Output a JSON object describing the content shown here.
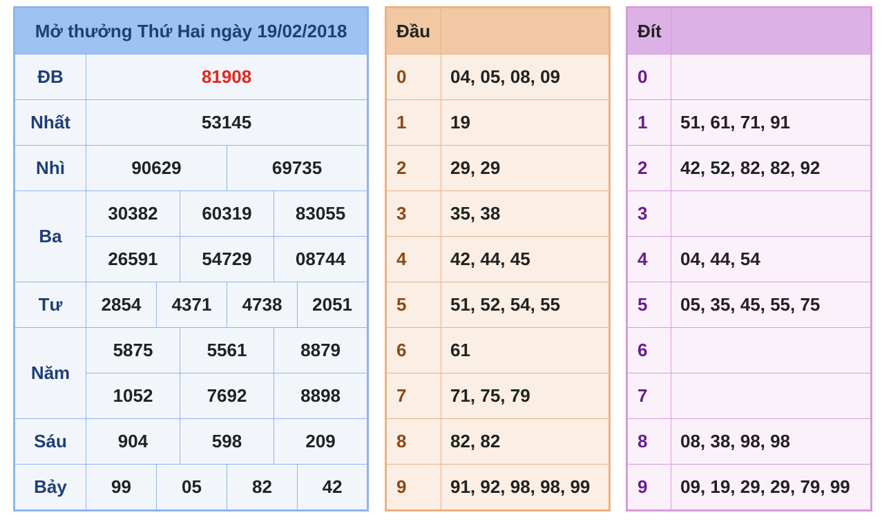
{
  "results": {
    "title": "Mở thưởng Thứ Hai ngày 19/02/2018",
    "prizes": [
      {
        "label": "ĐB",
        "values": [
          "81908"
        ]
      },
      {
        "label": "Nhất",
        "values": [
          "53145"
        ]
      },
      {
        "label": "Nhì",
        "values": [
          "90629",
          "69735"
        ]
      },
      {
        "label": "Ba",
        "values": [
          "30382",
          "60319",
          "83055",
          "26591",
          "54729",
          "08744"
        ]
      },
      {
        "label": "Tư",
        "values": [
          "2854",
          "4371",
          "4738",
          "2051"
        ]
      },
      {
        "label": "Năm",
        "values": [
          "5875",
          "5561",
          "8879",
          "1052",
          "7692",
          "8898"
        ]
      },
      {
        "label": "Sáu",
        "values": [
          "904",
          "598",
          "209"
        ]
      },
      {
        "label": "Bảy",
        "values": [
          "99",
          "05",
          "82",
          "42"
        ]
      }
    ]
  },
  "dau": {
    "header": "Đầu",
    "rows": [
      {
        "key": "0",
        "value": "04, 05, 08, 09"
      },
      {
        "key": "1",
        "value": "19"
      },
      {
        "key": "2",
        "value": "29, 29"
      },
      {
        "key": "3",
        "value": "35, 38"
      },
      {
        "key": "4",
        "value": "42, 44, 45"
      },
      {
        "key": "5",
        "value": "51, 52, 54, 55"
      },
      {
        "key": "6",
        "value": "61"
      },
      {
        "key": "7",
        "value": "71, 75, 79"
      },
      {
        "key": "8",
        "value": "82, 82"
      },
      {
        "key": "9",
        "value": "91, 92, 98, 98, 99"
      }
    ]
  },
  "dit": {
    "header": "Đít",
    "rows": [
      {
        "key": "0",
        "value": ""
      },
      {
        "key": "1",
        "value": "51, 61, 71, 91"
      },
      {
        "key": "2",
        "value": "42, 52, 82, 82, 92"
      },
      {
        "key": "3",
        "value": ""
      },
      {
        "key": "4",
        "value": "04, 44, 54"
      },
      {
        "key": "5",
        "value": "05, 35, 45, 55, 75"
      },
      {
        "key": "6",
        "value": ""
      },
      {
        "key": "7",
        "value": ""
      },
      {
        "key": "8",
        "value": "08, 38, 98, 98"
      },
      {
        "key": "9",
        "value": "09, 19, 29, 29, 79, 99"
      }
    ]
  },
  "colors": {
    "results_border": "#8db4ee",
    "results_header": "#9ec2f2",
    "special_prize": "#e0281f",
    "dau_border": "#eab282",
    "dit_border": "#d79ad8"
  }
}
